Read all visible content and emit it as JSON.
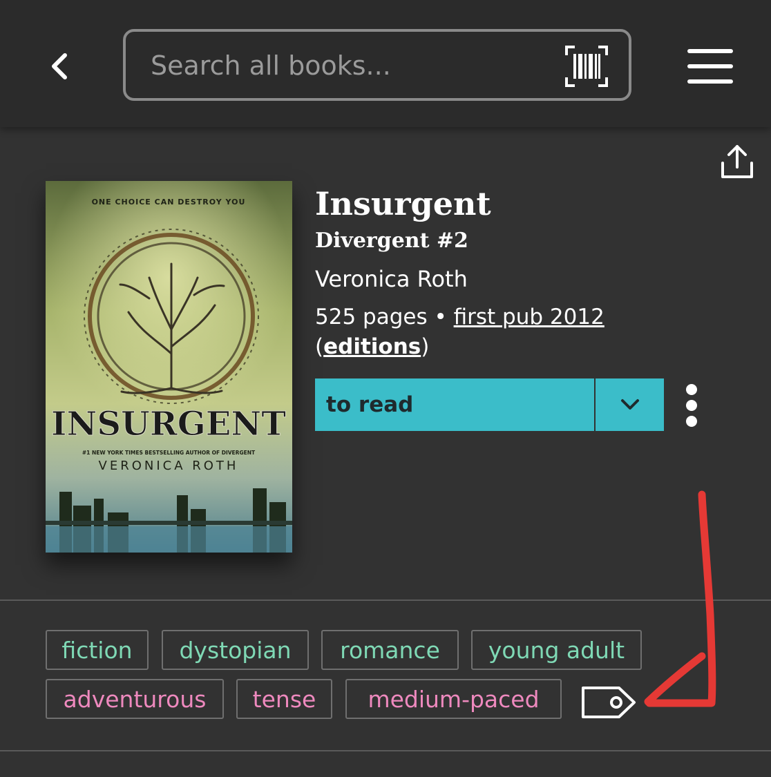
{
  "header": {
    "back_icon": "chevron-left-icon",
    "search_placeholder": "Search all books...",
    "barcode_icon": "barcode-scan-icon",
    "menu_icon": "hamburger-menu-icon"
  },
  "book": {
    "share_icon": "share-icon",
    "title": "Insurgent",
    "series": "Divergent #2",
    "author": "Veronica Roth",
    "pages": "525 pages",
    "separator": " • ",
    "first_pub": "first pub 2012",
    "paren_open": "(",
    "editions_label": "editions",
    "paren_close": ")",
    "cover": {
      "tagline": "ONE CHOICE CAN DESTROY YOU",
      "cover_title": "INSURGENT",
      "byline": "#1 NEW YORK TIMES BESTSELLING AUTHOR OF DIVERGENT",
      "cover_author": "VERONICA ROTH"
    }
  },
  "shelf": {
    "status_label": "to read",
    "dropdown_icon": "chevron-down-icon",
    "more_icon": "vertical-dots-icon"
  },
  "tags": {
    "genres": [
      "fiction",
      "dystopian",
      "romance",
      "young adult"
    ],
    "moods": [
      "adventurous",
      "tense",
      "medium-paced"
    ],
    "add_tag_icon": "tag-icon"
  },
  "colors": {
    "background": "#323232",
    "header_background": "#2b2b2b",
    "accent": "#3bbdc9",
    "genre_text": "#7fd9b5",
    "mood_text": "#ee89be",
    "annotation_arrow": "#e53935"
  }
}
